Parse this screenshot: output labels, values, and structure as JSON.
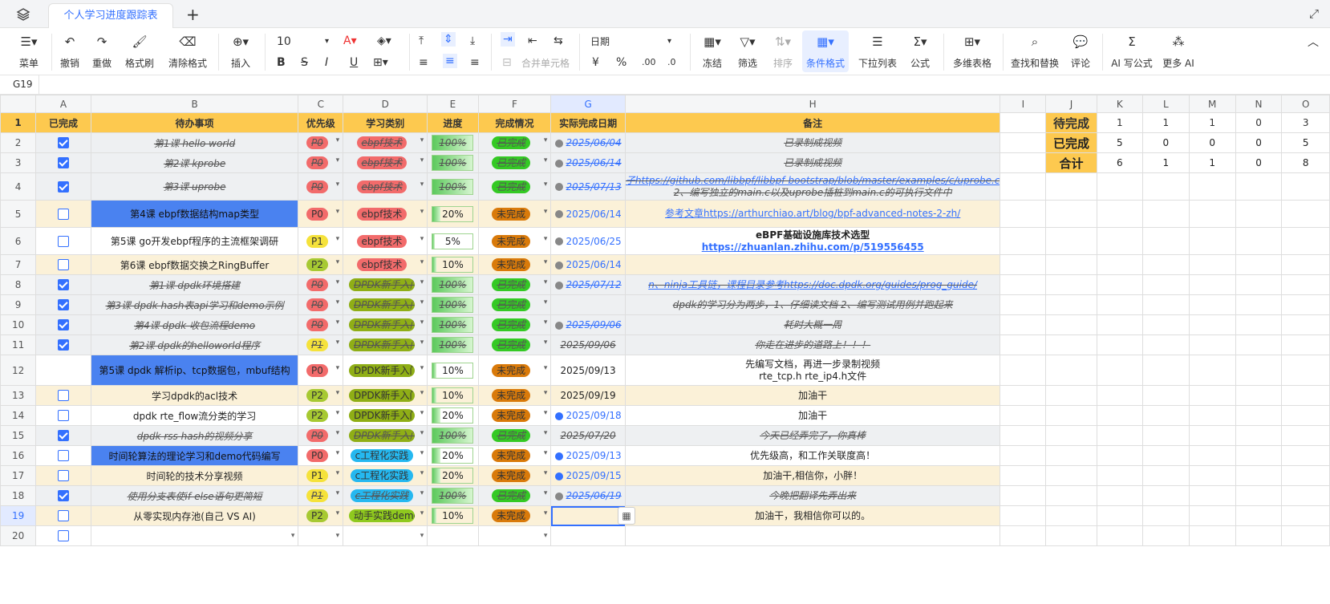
{
  "window": {
    "tab_title": "个人学习进度跟踪表"
  },
  "toolbar": {
    "menu": "菜单",
    "undo": "撤销",
    "redo": "重做",
    "format_painter": "格式刷",
    "clear_format": "清除格式",
    "insert": "插入",
    "font_size": "10",
    "date_format": "日期",
    "merge": "合并单元格",
    "freeze": "冻结",
    "filter": "筛选",
    "sort": "排序",
    "cond_format": "条件格式",
    "dropdown_list": "下拉列表",
    "formula": "公式",
    "multi_table": "多维表格",
    "find_replace": "查找和替换",
    "comment": "评论",
    "ai_formula": "AI 写公式",
    "more_ai": "更多 AI"
  },
  "cell_ref": "G19",
  "columns": [
    "A",
    "B",
    "C",
    "D",
    "E",
    "F",
    "G",
    "H",
    "I",
    "J",
    "K",
    "L",
    "M",
    "N",
    "O"
  ],
  "headers": [
    "已完成",
    "待办事项",
    "优先级",
    "学习类别",
    "进度",
    "完成情况",
    "实际完成日期",
    "备注"
  ],
  "rows": [
    {
      "n": "2",
      "done": true,
      "task": "第1课 hello world",
      "pri": "P0",
      "cat": "ebpf技术",
      "prog": "100%",
      "pct": 1.0,
      "status": "已完成",
      "date": "2025/06/04",
      "note": "已录制成视频",
      "strike": true
    },
    {
      "n": "3",
      "done": true,
      "task": "第2课 kprobe",
      "pri": "P0",
      "cat": "ebpf技术",
      "prog": "100%",
      "pct": 1.0,
      "status": "已完成",
      "date": "2025/06/14",
      "note": "已录制成视频",
      "strike": true
    },
    {
      "n": "4",
      "done": true,
      "task": "第3课 uprobe",
      "pri": "P0",
      "cat": "ebpf技术",
      "prog": "100%",
      "pct": 1.0,
      "status": "已完成",
      "date": "2025/07/13",
      "note": "子https://github.com/libbpf/libbpf-bootstrap/blob/master/examples/c/uprobe.c",
      "note2": "2、编写独立的main.c以及uprobe插桩到main.c的可执行文件中",
      "strike": true
    },
    {
      "n": "5",
      "done": false,
      "task": "第4课 ebpf数据结构map类型",
      "pri": "P0",
      "cat": "ebpf技术",
      "prog": "20%",
      "pct": 0.2,
      "status": "未完成",
      "date": "2025/06/14",
      "note": "参考文章https://arthurchiao.art/blog/bpf-advanced-notes-2-zh/",
      "strike": false,
      "blue": true
    },
    {
      "n": "6",
      "done": false,
      "task": "第5课 go开发ebpf程序的主流框架调研",
      "pri": "P1",
      "cat": "ebpf技术",
      "prog": "5%",
      "pct": 0.05,
      "status": "未完成",
      "date": "2025/06/25",
      "note": "eBPF基础设施库技术选型",
      "note2": "https://zhuanlan.zhihu.com/p/519556455",
      "strike": false
    },
    {
      "n": "7",
      "done": false,
      "task": "第6课 ebpf数据交换之RingBuffer",
      "pri": "P2",
      "cat": "ebpf技术",
      "prog": "10%",
      "pct": 0.1,
      "status": "未完成",
      "date": "2025/06/14",
      "note": "",
      "strike": false
    },
    {
      "n": "8",
      "done": true,
      "task": "第1课 dpdk环境搭建",
      "pri": "P0",
      "cat": "DPDK新手入门",
      "prog": "100%",
      "pct": 1.0,
      "status": "已完成",
      "date": "2025/07/12",
      "note": "n、ninja工具链，课程目录参考https://doc.dpdk.org/guides/prog_guide/",
      "strike": true
    },
    {
      "n": "9",
      "done": true,
      "task": "第3课 dpdk hash表api学习和demo示例",
      "pri": "P0",
      "cat": "DPDK新手入门",
      "prog": "100%",
      "pct": 1.0,
      "status": "已完成",
      "date": "",
      "note": "dpdk的学习分为两步，1、仔细读文档 2、编写测试用例并跑起来",
      "strike": true
    },
    {
      "n": "10",
      "done": true,
      "task": "第4课 dpdk 收包流程demo",
      "pri": "P0",
      "cat": "DPDK新手入门",
      "prog": "100%",
      "pct": 1.0,
      "status": "已完成",
      "date": "2025/09/06",
      "note": "耗时大概一周",
      "strike": true
    },
    {
      "n": "11",
      "done": true,
      "task": "第2课 dpdk的helloworld程序",
      "pri": "P1",
      "cat": "DPDK新手入门",
      "prog": "100%",
      "pct": 1.0,
      "status": "已完成",
      "date": "2025/09/06",
      "note": "你走在进步的道路上！！！",
      "strike": true
    },
    {
      "n": "12",
      "done": null,
      "task": "第5课 dpdk 解析ip、tcp数据包，mbuf结构",
      "pri": "P0",
      "cat": "DPDK新手入门",
      "prog": "10%",
      "pct": 0.1,
      "status": "未完成",
      "date": "2025/09/13",
      "note": "先编写文档，再进一步录制视频",
      "note2": "rte_tcp.h rte_ip4.h文件",
      "strike": false,
      "blue": true
    },
    {
      "n": "13",
      "done": false,
      "task": "学习dpdk的acl技术",
      "pri": "P2",
      "cat": "DPDK新手入门",
      "prog": "10%",
      "pct": 0.1,
      "status": "未完成",
      "date": "2025/09/19",
      "note": "加油干",
      "strike": false
    },
    {
      "n": "14",
      "done": false,
      "task": "dpdk rte_flow流分类的学习",
      "pri": "P2",
      "cat": "DPDK新手入门",
      "prog": "20%",
      "pct": 0.2,
      "status": "未完成",
      "date": "2025/09/18",
      "note": "加油干",
      "strike": false
    },
    {
      "n": "15",
      "done": true,
      "task": "dpdk rss hash的视频分享",
      "pri": "P0",
      "cat": "DPDK新手入门",
      "prog": "100%",
      "pct": 1.0,
      "status": "已完成",
      "date": "2025/07/20",
      "note": "今天已经弄完了，你真棒",
      "strike": true
    },
    {
      "n": "16",
      "done": false,
      "task": "时间轮算法的理论学习和demo代码编写",
      "pri": "P0",
      "cat": "c工程化实践",
      "prog": "20%",
      "pct": 0.2,
      "status": "未完成",
      "date": "2025/09/13",
      "note": "优先级高，和工作关联度高！",
      "strike": false,
      "blue": true
    },
    {
      "n": "17",
      "done": false,
      "task": "时间轮的技术分享视频",
      "pri": "P1",
      "cat": "c工程化实践",
      "prog": "20%",
      "pct": 0.2,
      "status": "未完成",
      "date": "2025/09/15",
      "note": "加油干,相信你，小胖！",
      "strike": false
    },
    {
      "n": "18",
      "done": true,
      "task": "使用分支表使if-else语句更简短",
      "pri": "P1",
      "cat": "c工程化实践",
      "prog": "100%",
      "pct": 1.0,
      "status": "已完成",
      "date": "2025/06/19",
      "note": "今晚把翻译先弄出来",
      "strike": true
    },
    {
      "n": "19",
      "done": false,
      "task": "从零实现内存池(自己 VS AI)",
      "pri": "P2",
      "cat": "动手实践demo",
      "prog": "10%",
      "pct": 0.1,
      "status": "未完成",
      "date": "",
      "note": "加油干，我相信你可以的。",
      "strike": false
    },
    {
      "n": "20",
      "done": false,
      "task": "",
      "pri": "",
      "cat": "",
      "prog": "",
      "pct": 0,
      "status": "",
      "date": "",
      "note": "",
      "strike": false
    }
  ],
  "summary": {
    "labels": [
      "待完成",
      "已完成",
      "合计"
    ],
    "values": [
      [
        "1",
        "1",
        "1",
        "0",
        "3"
      ],
      [
        "5",
        "0",
        "0",
        "0",
        "5"
      ],
      [
        "6",
        "1",
        "1",
        "0",
        "8"
      ]
    ]
  },
  "colors": {
    "accent": "#3370ff",
    "header_yellow": "#fdc94f"
  }
}
